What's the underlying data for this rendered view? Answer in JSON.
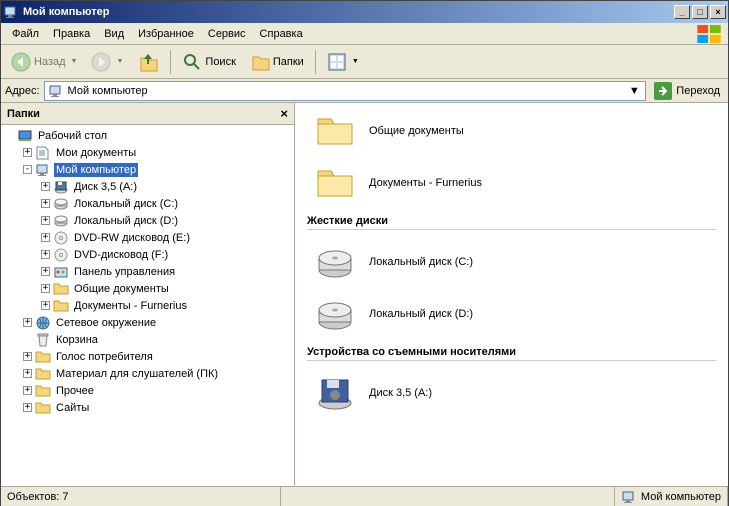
{
  "window": {
    "title": "Мой компьютер"
  },
  "menu": {
    "file": "Файл",
    "edit": "Правка",
    "view": "Вид",
    "favorites": "Избранное",
    "tools": "Сервис",
    "help": "Справка"
  },
  "toolbar": {
    "back": "Назад",
    "search": "Поиск",
    "folders": "Папки"
  },
  "address": {
    "label": "Адрес:",
    "value": "Мой компьютер",
    "go": "Переход"
  },
  "sidebar": {
    "title": "Папки"
  },
  "tree": {
    "root": "Рабочий стол",
    "items": [
      {
        "label": "Мои документы",
        "indent": 1,
        "exp": "+",
        "icon": "docs"
      },
      {
        "label": "Мой компьютер",
        "indent": 1,
        "exp": "-",
        "icon": "computer",
        "selected": true
      },
      {
        "label": "Диск 3,5 (A:)",
        "indent": 2,
        "exp": "+",
        "icon": "floppy"
      },
      {
        "label": "Локальный диск (C:)",
        "indent": 2,
        "exp": "+",
        "icon": "hdd"
      },
      {
        "label": "Локальный диск (D:)",
        "indent": 2,
        "exp": "+",
        "icon": "hdd"
      },
      {
        "label": "DVD-RW дисковод (E:)",
        "indent": 2,
        "exp": "+",
        "icon": "cd"
      },
      {
        "label": "DVD-дисковод (F:)",
        "indent": 2,
        "exp": "+",
        "icon": "cd"
      },
      {
        "label": "Панель управления",
        "indent": 2,
        "exp": "+",
        "icon": "cpl"
      },
      {
        "label": "Общие документы",
        "indent": 2,
        "exp": "+",
        "icon": "folder"
      },
      {
        "label": "Документы - Furnerius",
        "indent": 2,
        "exp": "+",
        "icon": "folder"
      },
      {
        "label": "Сетевое окружение",
        "indent": 1,
        "exp": "+",
        "icon": "network"
      },
      {
        "label": "Корзина",
        "indent": 1,
        "exp": "",
        "icon": "bin"
      },
      {
        "label": "Голос потребителя",
        "indent": 1,
        "exp": "+",
        "icon": "folder"
      },
      {
        "label": "Материал для слушателей (ПК)",
        "indent": 1,
        "exp": "+",
        "icon": "folder"
      },
      {
        "label": "Прочее",
        "indent": 1,
        "exp": "+",
        "icon": "folder"
      },
      {
        "label": "Сайты",
        "indent": 1,
        "exp": "+",
        "icon": "folder"
      }
    ]
  },
  "content": {
    "shared_docs": "Общие документы",
    "user_docs": "Документы - Furnerius",
    "section_hdd": "Жесткие диски",
    "hdd_c": "Локальный диск (C:)",
    "hdd_d": "Локальный диск (D:)",
    "section_removable": "Устройства со съемными носителями",
    "floppy": "Диск 3,5 (A:)"
  },
  "status": {
    "objects": "Объектов: 7",
    "location": "Мой компьютер"
  }
}
